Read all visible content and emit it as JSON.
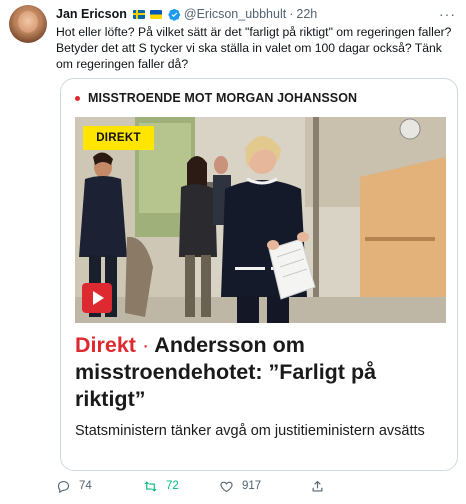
{
  "tweet": {
    "author_name": "Jan Ericson",
    "author_handle": "@Ericson_ubbhult",
    "separator": "·",
    "time": "22h",
    "text": "Hot eller löfte? På vilket sätt är det \"farligt på riktigt\" om regeringen faller? Betyder det att S tycker vi ska ställa in valet om 100 dagar också? Tänk om regeringen faller då?",
    "more_icon": "ellipsis-icon"
  },
  "card": {
    "label": "MISSTROENDE MOT MORGAN JOHANSSON",
    "badge": "DIREKT",
    "headline_kicker": "Direkt",
    "headline_sep": "·",
    "headline_rest": "Andersson om misstroendehotet: ”Farligt på riktigt”",
    "subtitle": "Statsministern tänker avgå om justitieministern avsätts",
    "accent_color": "#dd2a30",
    "badge_color": "#ffe500"
  },
  "actions": {
    "reply_count": "74",
    "retweet_count": "72",
    "like_count": "917",
    "colors": {
      "retweet_active": "#00ba7c",
      "muted": "#536471"
    }
  }
}
